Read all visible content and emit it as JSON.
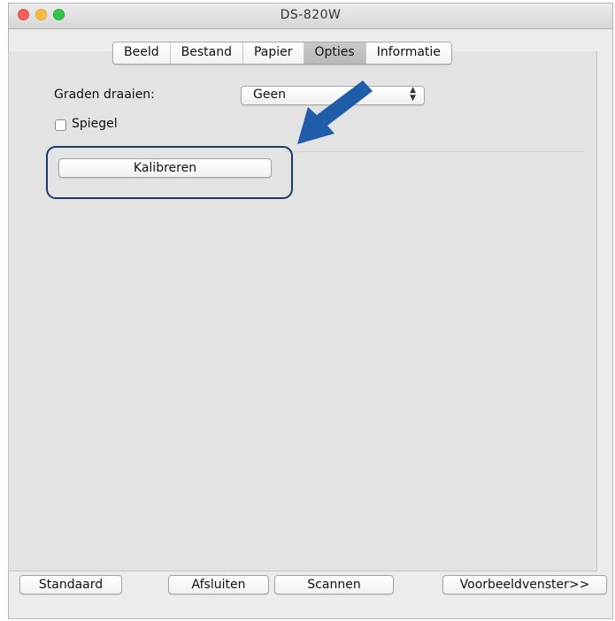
{
  "window": {
    "title": "DS-820W"
  },
  "tabs": [
    {
      "label": "Beeld",
      "active": false
    },
    {
      "label": "Bestand",
      "active": false
    },
    {
      "label": "Papier",
      "active": false
    },
    {
      "label": "Opties",
      "active": true
    },
    {
      "label": "Informatie",
      "active": false
    }
  ],
  "options": {
    "rotate_label": "Graden draaien:",
    "rotate_value": "Geen",
    "mirror_label": "Spiegel",
    "mirror_checked": false,
    "calibrate_label": "Kalibreren"
  },
  "footer": {
    "default_label": "Standaard",
    "close_label": "Afsluiten",
    "scan_label": "Scannen",
    "preview_label": "Voorbeeldvenster>>"
  },
  "annotation": {
    "arrow_color": "#1f5da8",
    "highlight_color": "#1b3b66"
  }
}
